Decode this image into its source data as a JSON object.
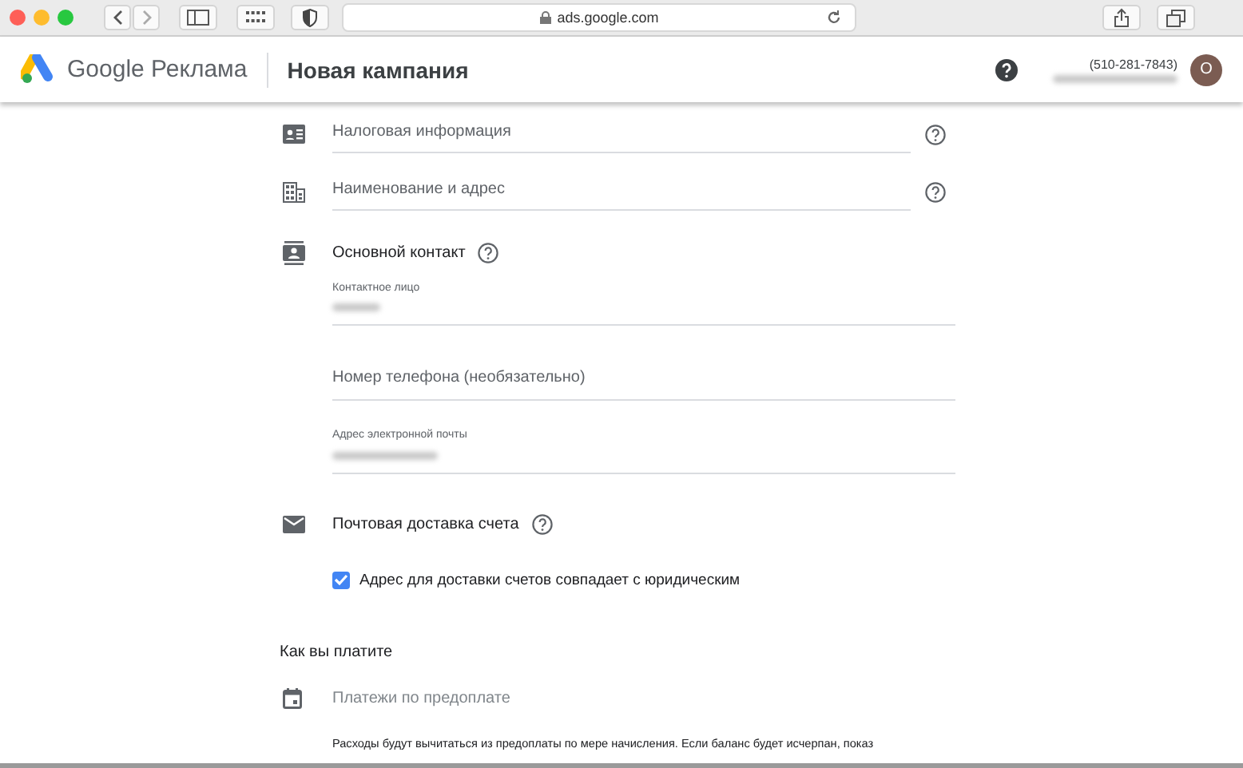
{
  "browser": {
    "url": "ads.google.com"
  },
  "header": {
    "brand": "Google",
    "product": "Реклама",
    "title": "Новая кампания",
    "phone": "(510-281-7843)",
    "avatar": "О"
  },
  "rows": [
    {
      "kind": "tax",
      "label": "Налоговая информация"
    },
    {
      "kind": "building",
      "label": "Наименование и адрес"
    }
  ],
  "contact": {
    "title": "Основной контакт",
    "fields": [
      {
        "label": "Контактное лицо",
        "redacted": true
      },
      {
        "placeholder": "Номер телефона (необязательно)"
      },
      {
        "label": "Адрес электронной почты",
        "redacted": true
      }
    ]
  },
  "mail": {
    "title": "Почтовая доставка счета",
    "checkbox": {
      "label": "Адрес для доставки счетов совпадает с юридическим",
      "checked": true
    }
  },
  "payment": {
    "heading": "Как вы платите",
    "method": "Платежи по предоплате",
    "description": "Расходы будут вычитаться из предоплаты по мере начисления. Если баланс будет исчерпан, показ"
  }
}
